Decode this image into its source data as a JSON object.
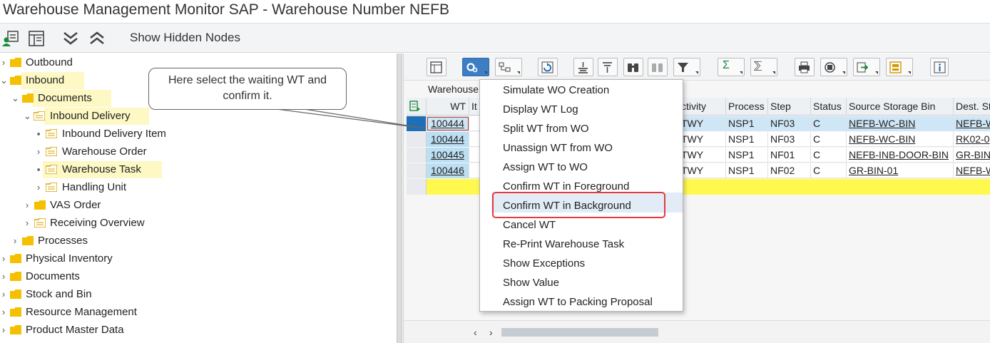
{
  "window": {
    "title": "Warehouse Management Monitor SAP - Warehouse Number NEFB"
  },
  "topbar": {
    "show_hidden_nodes": "Show Hidden Nodes",
    "icons": [
      "user-tree-icon",
      "layout-icon",
      "expand-all-icon",
      "collapse-all-icon"
    ]
  },
  "tree": {
    "nodes": [
      {
        "label": "Outbound",
        "chevron": "›"
      },
      {
        "label": "Inbound",
        "chevron": "⌄"
      },
      {
        "label": "Documents",
        "chevron": "⌄"
      },
      {
        "label": "Inbound Delivery",
        "chevron": "⌄"
      },
      {
        "label": "Inbound Delivery Item",
        "chevron": "▪"
      },
      {
        "label": "Warehouse Order",
        "chevron": "›"
      },
      {
        "label": "Warehouse Task",
        "chevron": "▪"
      },
      {
        "label": "Handling Unit",
        "chevron": "›"
      },
      {
        "label": "VAS Order",
        "chevron": "›"
      },
      {
        "label": "Receiving Overview",
        "chevron": "›"
      },
      {
        "label": "Processes",
        "chevron": "›"
      },
      {
        "label": "Physical Inventory",
        "chevron": "›"
      },
      {
        "label": "Documents",
        "chevron": "›"
      },
      {
        "label": "Stock and Bin",
        "chevron": "›"
      },
      {
        "label": "Resource Management",
        "chevron": "›"
      },
      {
        "label": "Product Master Data",
        "chevron": "›"
      }
    ]
  },
  "callout": {
    "text": "Here select the waiting WT and confirm it."
  },
  "grid": {
    "title": "Warehouse",
    "columns": [
      "WT",
      "It",
      "ctivity",
      "Process",
      "Step",
      "Status",
      "Source Storage Bin",
      "Dest. St"
    ],
    "rows": [
      {
        "wt": "100444",
        "activity": "TWY",
        "process": "NSP1",
        "step": "NF03",
        "status": "C",
        "source": "NEFB-WC-BIN",
        "dest": "NEFB-W"
      },
      {
        "wt": "100444",
        "activity": "TWY",
        "process": "NSP1",
        "step": "NF03",
        "status": "C",
        "source": "NEFB-WC-BIN",
        "dest": "RK02-0"
      },
      {
        "wt": "100445",
        "activity": "TWY",
        "process": "NSP1",
        "step": "NF01",
        "status": "C",
        "source": "NEFB-INB-DOOR-BIN",
        "dest": "GR-BIN"
      },
      {
        "wt": "100446",
        "activity": "TWY",
        "process": "NSP1",
        "step": "NF02",
        "status": "C",
        "source": "GR-BIN-01",
        "dest": "NEFB-W"
      }
    ]
  },
  "menu": {
    "items": [
      "Simulate WO Creation",
      "Display WT Log",
      "Split WT from WO",
      "Unassign WT from WO",
      "Assign WT to WO",
      "Confirm WT in Foreground",
      "Confirm WT in Background",
      "Cancel WT",
      "Re-Print Warehouse Task",
      "Show Exceptions",
      "Show Value",
      "Assign WT to Packing Proposal"
    ],
    "highlighted_index": 6
  },
  "colors": {
    "folder": "#f4c000",
    "node_highlight": "#fdf8c4",
    "active_button": "#3c7dc4",
    "selected_row": "#cfe6f6",
    "empty_row": "#fff94d",
    "callout_border": "#e5393b"
  }
}
